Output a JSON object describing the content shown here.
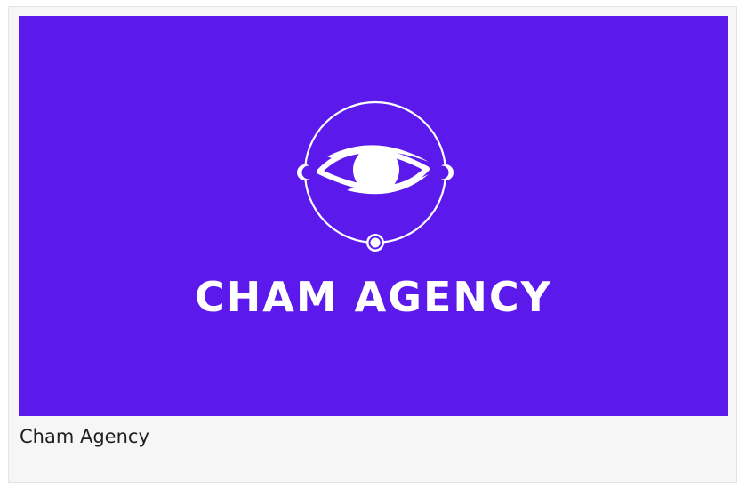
{
  "card": {
    "banner": {
      "background_color": "#5b19eb",
      "logo_icon": "eye-in-circle-icon",
      "wordmark": "CHAM AGENCY"
    },
    "caption": "Cham Agency"
  }
}
